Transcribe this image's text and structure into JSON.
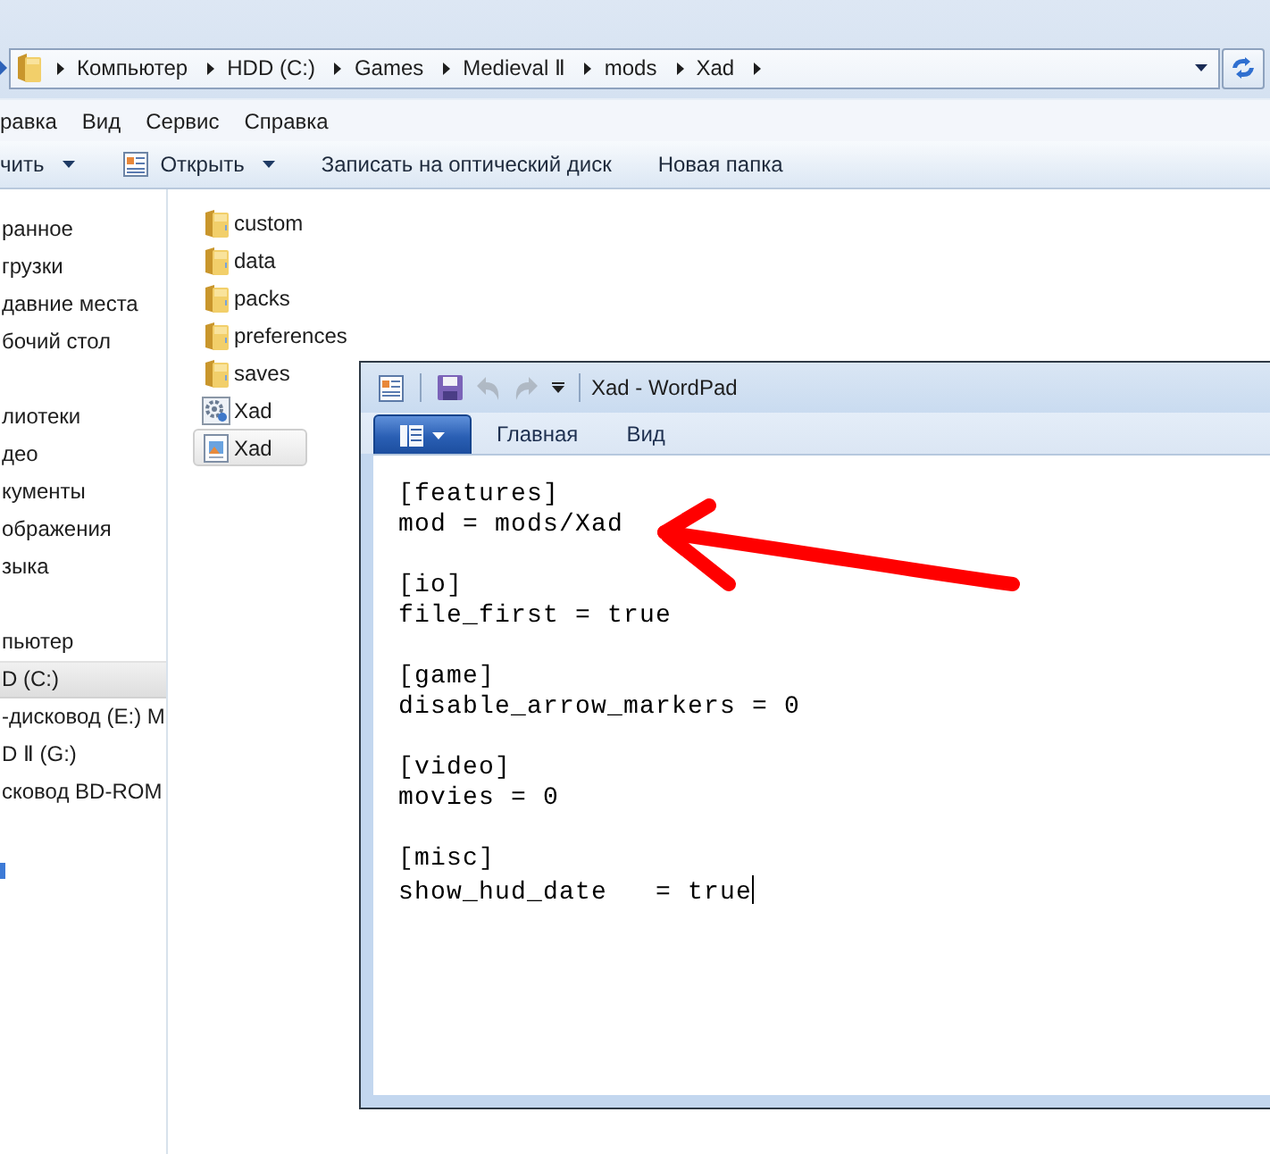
{
  "explorer": {
    "address_bar": {
      "crumbs": [
        "Компьютер",
        "HDD (C:)",
        "Games",
        "Medieval Ⅱ",
        "mods",
        "Xad"
      ]
    },
    "menu": [
      "равка",
      "Вид",
      "Сервис",
      "Справка"
    ],
    "toolbar": [
      {
        "label": "чить",
        "kind": "plain",
        "has_dropdown": true
      },
      {
        "label": "Открыть",
        "kind": "open",
        "has_dropdown": true
      },
      {
        "label": "Записать на оптический диск",
        "kind": "plain",
        "has_dropdown": false
      },
      {
        "label": "Новая папка",
        "kind": "plain",
        "has_dropdown": false
      }
    ],
    "sidebar": {
      "groups": [
        {
          "items": [
            {
              "label": "ранное",
              "selected": false
            },
            {
              "label": "грузки",
              "selected": false
            },
            {
              "label": "давние места",
              "selected": false
            },
            {
              "label": "бочий стол",
              "selected": false
            }
          ]
        },
        {
          "items": [
            {
              "label": "лиотеки",
              "selected": false
            },
            {
              "label": "део",
              "selected": false
            },
            {
              "label": "кументы",
              "selected": false
            },
            {
              "label": "ображения",
              "selected": false
            },
            {
              "label": "зыка",
              "selected": false
            }
          ]
        },
        {
          "items": [
            {
              "label": "пьютер",
              "selected": false
            },
            {
              "label": "D (C:)",
              "selected": true
            },
            {
              "label": "-дисковод (E:) M",
              "selected": false
            },
            {
              "label": "D Ⅱ (G:)",
              "selected": false
            },
            {
              "label": "сковод BD-ROM",
              "selected": false
            }
          ]
        }
      ]
    },
    "files": [
      {
        "name": "custom",
        "kind": "folder",
        "selected": false
      },
      {
        "name": "data",
        "kind": "folder",
        "selected": false
      },
      {
        "name": "packs",
        "kind": "folder",
        "selected": false
      },
      {
        "name": "preferences",
        "kind": "folder",
        "selected": false
      },
      {
        "name": "saves",
        "kind": "folder",
        "selected": false
      },
      {
        "name": "Xad",
        "kind": "config",
        "selected": false
      },
      {
        "name": "Xad",
        "kind": "document",
        "selected": true
      }
    ]
  },
  "wordpad": {
    "title": "Xad - WordPad",
    "quick_access": [
      {
        "kind": "save",
        "disabled": false
      },
      {
        "kind": "undo",
        "disabled": true
      },
      {
        "kind": "redo",
        "disabled": true
      }
    ],
    "tabs": [
      {
        "label": "Главная",
        "selected": false
      },
      {
        "label": "Вид",
        "selected": false
      }
    ],
    "document": {
      "blocks": [
        {
          "lines": [
            "[features]",
            "mod = mods/Xad"
          ]
        },
        {
          "lines": [
            "[io]",
            "file_first = true"
          ]
        },
        {
          "lines": [
            "[game]",
            "disable_arrow_markers = 0"
          ]
        },
        {
          "lines": [
            "[video]",
            "movies = 0"
          ]
        },
        {
          "lines": [
            "[misc]",
            "show_hud_date   = true"
          ]
        }
      ],
      "caret_at_end": true
    }
  }
}
